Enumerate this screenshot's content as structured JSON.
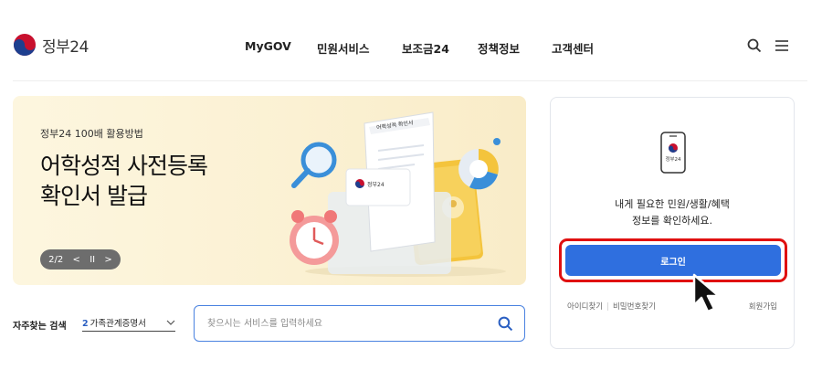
{
  "header": {
    "logo_text": "정부24",
    "nav": [
      "MyGOV",
      "민원서비스",
      "보조금24",
      "정책정보",
      "고객센터"
    ],
    "icons": [
      "search-icon",
      "menu-icon"
    ]
  },
  "banner": {
    "subtitle": "정부24 100배 활용방법",
    "title_line1": "어학성적 사전등록",
    "title_line2": "확인서 발급",
    "pager": {
      "current": "2/2",
      "prev": "<",
      "pause": "II",
      "next": ">"
    },
    "illustration_doc_label": "어학성적 확인서",
    "illustration_logo_text": "정부24"
  },
  "quick_search": {
    "label": "자주찾는 검색",
    "selected_num": "2",
    "selected_text": "가족관계증명서"
  },
  "search": {
    "placeholder": "찾으시는 서비스를 입력하세요"
  },
  "login_card": {
    "phone_logo_text": "정부24",
    "message_line1": "내게 필요한 민원/생활/혜택",
    "message_line2": "정보를 확인하세요.",
    "login_label": "로그인",
    "find_id": "아이디찾기",
    "find_pw": "비밀번호찾기",
    "join": "회원가입"
  },
  "colors": {
    "accent_blue": "#2f6fdf",
    "highlight_red": "#e01010",
    "banner_bg": "#fbf1d3"
  }
}
